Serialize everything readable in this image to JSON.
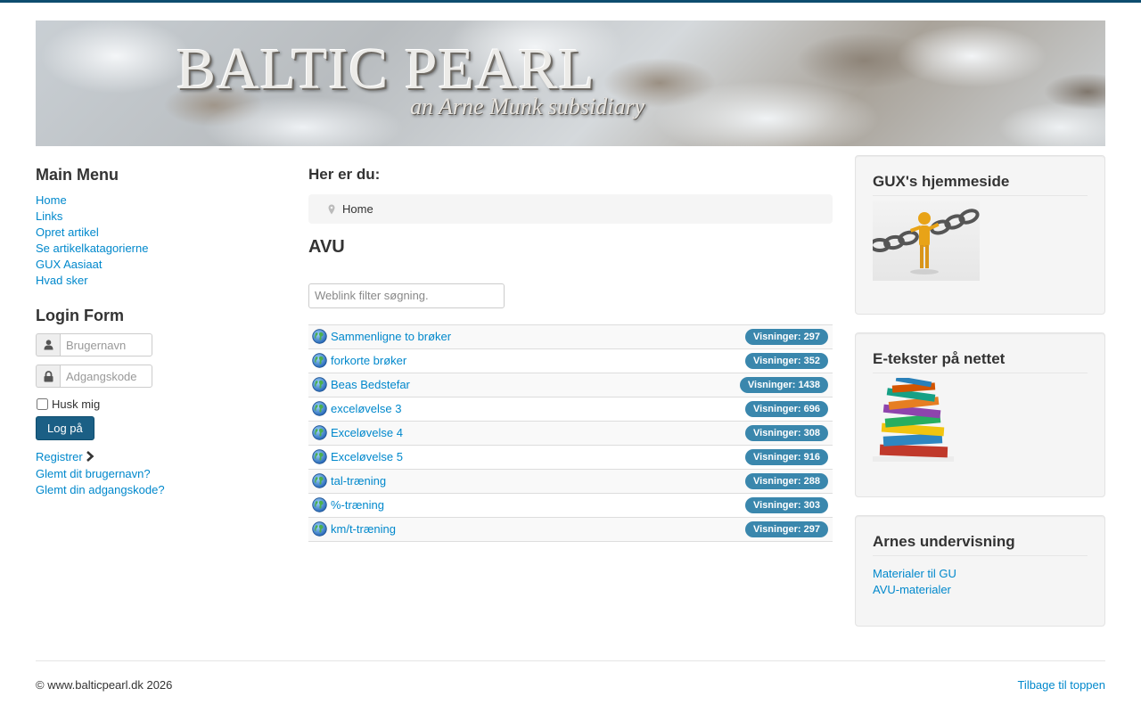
{
  "banner": {
    "title": "BALTIC PEARL",
    "subtitle": "an Arne Munk subsidiary"
  },
  "main_menu": {
    "title": "Main Menu",
    "items": [
      {
        "label": "Home"
      },
      {
        "label": "Links"
      },
      {
        "label": "Opret artikel"
      },
      {
        "label": "Se artikelkatagorierne"
      },
      {
        "label": "GUX Aasiaat"
      },
      {
        "label": "Hvad sker"
      }
    ]
  },
  "login": {
    "title": "Login Form",
    "username_placeholder": "Brugernavn",
    "password_placeholder": "Adgangskode",
    "remember_label": "Husk mig",
    "submit_label": "Log på",
    "register_label": "Registrer",
    "forgot_username": "Glemt dit brugernavn?",
    "forgot_password": "Glemt din adgangskode?"
  },
  "breadcrumb": {
    "title": "Her er du:",
    "home": "Home"
  },
  "category": {
    "title": "AVU",
    "filter_placeholder": "Weblink filter søgning.",
    "links": [
      {
        "title": "Sammenligne to brøker",
        "hits": "Visninger: 297"
      },
      {
        "title": "forkorte brøker",
        "hits": "Visninger: 352"
      },
      {
        "title": "Beas Bedstefar",
        "hits": "Visninger: 1438"
      },
      {
        "title": "exceløvelse 3",
        "hits": "Visninger: 696"
      },
      {
        "title": "Exceløvelse 4",
        "hits": "Visninger: 308"
      },
      {
        "title": "Exceløvelse 5",
        "hits": "Visninger: 916"
      },
      {
        "title": "tal-træning",
        "hits": "Visninger: 288"
      },
      {
        "title": "%-træning",
        "hits": "Visninger: 303"
      },
      {
        "title": "km/t-træning",
        "hits": "Visninger: 297"
      }
    ]
  },
  "sidebar": {
    "gux_title": "GUX's hjemmeside",
    "etekster_title": "E-tekster på nettet",
    "arnes_title": "Arnes undervisning",
    "arnes_links": [
      {
        "label": "Materialer til GU"
      },
      {
        "label": "AVU-materialer"
      }
    ]
  },
  "footer": {
    "copyright": "© www.balticpearl.dk 2026",
    "back_to_top": "Tilbage til toppen"
  },
  "colors": {
    "link": "#0088cc",
    "badge": "#3a87ad",
    "button": "#1b5f85",
    "topline": "#0e4d6f"
  }
}
